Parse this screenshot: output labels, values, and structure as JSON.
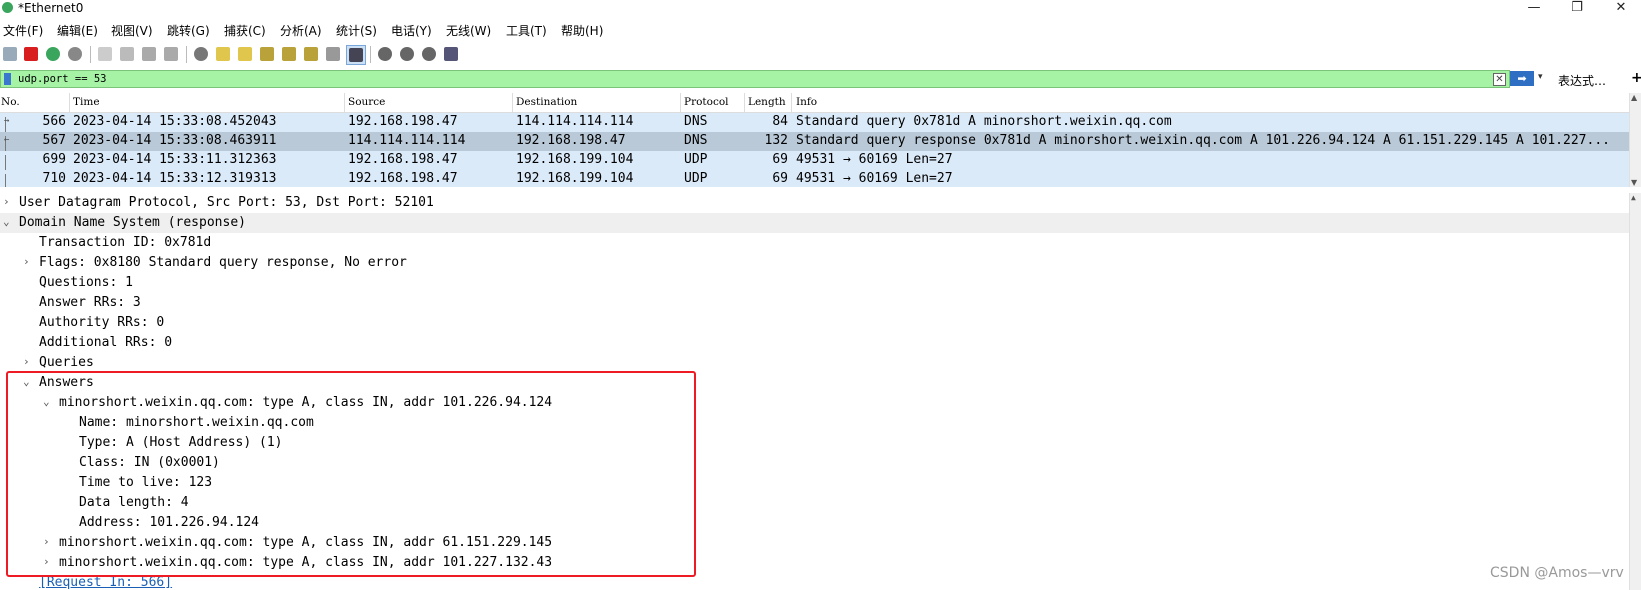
{
  "window": {
    "title": "*Ethernet0",
    "controls": {
      "minimize": "—",
      "maximize": "❐",
      "close": "✕"
    }
  },
  "menu": [
    "文件(F)",
    "编辑(E)",
    "视图(V)",
    "跳转(G)",
    "捕获(C)",
    "分析(A)",
    "统计(S)",
    "电话(Y)",
    "无线(W)",
    "工具(T)",
    "帮助(H)"
  ],
  "filter": {
    "value": "udp.port == 53",
    "apply_label": "➡",
    "clear_label": "✕",
    "dropdown_label": "▾",
    "expression_label": "表达式…",
    "add_label": "+"
  },
  "packet_list": {
    "columns": [
      "No.",
      "Time",
      "Source",
      "Destination",
      "Protocol",
      "Length",
      "Info"
    ],
    "rows": [
      {
        "no": "566",
        "time": "2023-04-14 15:33:08.452043",
        "source": "192.168.198.47",
        "destination": "114.114.114.114",
        "protocol": "DNS",
        "length": "84",
        "info": "Standard query 0x781d A minorshort.weixin.qq.com",
        "bg": "#dbeaf9",
        "marker": "→"
      },
      {
        "no": "567",
        "time": "2023-04-14 15:33:08.463911",
        "source": "114.114.114.114",
        "destination": "192.168.198.47",
        "protocol": "DNS",
        "length": "132",
        "info": "Standard query response 0x781d A minorshort.weixin.qq.com A 101.226.94.124 A 61.151.229.145 A 101.227...",
        "bg": "#b9c9d8",
        "marker": "←"
      },
      {
        "no": "699",
        "time": "2023-04-14 15:33:11.312363",
        "source": "192.168.198.47",
        "destination": "192.168.199.104",
        "protocol": "UDP",
        "length": "69",
        "info": "49531 → 60169 Len=27",
        "bg": "#dbeaf9",
        "marker": ""
      },
      {
        "no": "710",
        "time": "2023-04-14 15:33:12.319313",
        "source": "192.168.198.47",
        "destination": "192.168.199.104",
        "protocol": "UDP",
        "length": "69",
        "info": "49531 → 60169 Len=27",
        "bg": "#dbeaf9",
        "marker": ""
      }
    ]
  },
  "details": [
    {
      "text": "User Datagram Protocol, Src Port: 53, Dst Port: 52101",
      "level": 0,
      "chevron": "›",
      "bg": "#ffffff"
    },
    {
      "text": "Domain Name System (response)",
      "level": 0,
      "chevron": "⌄",
      "bg": "#efefef"
    },
    {
      "text": "Transaction ID: 0x781d",
      "level": 1,
      "chevron": "",
      "bg": "#ffffff"
    },
    {
      "text": "Flags: 0x8180 Standard query response, No error",
      "level": 1,
      "chevron": "›",
      "bg": "#ffffff"
    },
    {
      "text": "Questions: 1",
      "level": 1,
      "chevron": "",
      "bg": "#ffffff"
    },
    {
      "text": "Answer RRs: 3",
      "level": 1,
      "chevron": "",
      "bg": "#ffffff"
    },
    {
      "text": "Authority RRs: 0",
      "level": 1,
      "chevron": "",
      "bg": "#ffffff"
    },
    {
      "text": "Additional RRs: 0",
      "level": 1,
      "chevron": "",
      "bg": "#ffffff"
    },
    {
      "text": "Queries",
      "level": 1,
      "chevron": "›",
      "bg": "#ffffff"
    },
    {
      "text": "Answers",
      "level": 1,
      "chevron": "⌄",
      "bg": "#ffffff"
    },
    {
      "text": "minorshort.weixin.qq.com: type A, class IN, addr 101.226.94.124",
      "level": 2,
      "chevron": "⌄",
      "bg": "#ffffff"
    },
    {
      "text": "Name: minorshort.weixin.qq.com",
      "level": 3,
      "chevron": "",
      "bg": "#ffffff"
    },
    {
      "text": "Type: A (Host Address) (1)",
      "level": 3,
      "chevron": "",
      "bg": "#ffffff"
    },
    {
      "text": "Class: IN (0x0001)",
      "level": 3,
      "chevron": "",
      "bg": "#ffffff"
    },
    {
      "text": "Time to live: 123",
      "level": 3,
      "chevron": "",
      "bg": "#ffffff"
    },
    {
      "text": "Data length: 4",
      "level": 3,
      "chevron": "",
      "bg": "#ffffff"
    },
    {
      "text": "Address: 101.226.94.124",
      "level": 3,
      "chevron": "",
      "bg": "#ffffff"
    },
    {
      "text": "minorshort.weixin.qq.com: type A, class IN, addr 61.151.229.145",
      "level": 2,
      "chevron": "›",
      "bg": "#ffffff"
    },
    {
      "text": "minorshort.weixin.qq.com: type A, class IN, addr 101.227.132.43",
      "level": 2,
      "chevron": "›",
      "bg": "#ffffff"
    },
    {
      "text": "[Request In: 566]",
      "level": 1,
      "chevron": "",
      "bg": "#ffffff",
      "link": true
    }
  ],
  "watermark": "CSDN @Amos—vrv",
  "colors": {
    "filter_bg": "#a6f3a6",
    "highlight_box": "#ee1b24",
    "link": "#1a5fb4"
  }
}
